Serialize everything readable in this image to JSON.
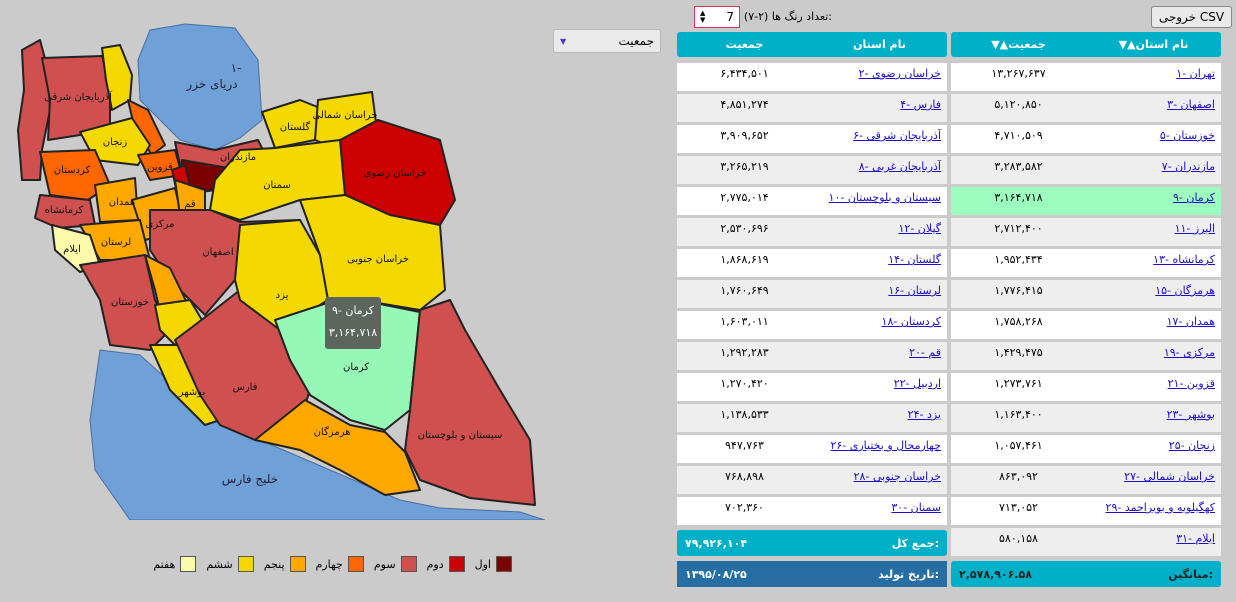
{
  "toolbar": {
    "csv_button": "خروجی CSV",
    "color_count_label": "تعداد رنگ ها (۲-۷):",
    "color_count_value": "7",
    "metric_select": "جمعیت"
  },
  "map": {
    "sea_north": "دریای خزر",
    "sea_north_number": "۱-",
    "sea_south": "خلیج فارس",
    "tooltip": {
      "title": "۹- کرمان",
      "value": "۳,۱۶۴,۷۱۸"
    },
    "provinces": {
      "tehran": "تهران",
      "khorasan_razavi": "خراسان رضوی",
      "esfahan": "اصفهان",
      "fars": "فارس",
      "khuzestan": "خوزستان",
      "azar_sharghi": "آذربایجان شرقی",
      "mazandaran": "مازندران",
      "azar_gharbi": "آذربایجان غربی",
      "kerman": "کرمان",
      "sistan": "سیستان و بلوچستان",
      "alborz": "البرز",
      "gilan": "گیلان",
      "kermanshah": "کرمانشاه",
      "golestan": "گلستان",
      "hormozgan": "هرمزگان",
      "lorestan": "لرستان",
      "hamadan": "همدان",
      "kordestan": "کردستان",
      "markazi": "مرکزی",
      "qom": "قم",
      "qazvin": "قزوین",
      "ardabil": "اردبیل",
      "bushehr": "بوشهر",
      "yazd": "یزد",
      "zanjan": "زنجان",
      "chaharmahal": "چهارمحال و بختیاری",
      "khorasan_shomali": "خراسان شمالی",
      "khorasan_jonubi": "خراسان جنوبی",
      "kohgiluyeh": "کهگیلویه و بویراحمد",
      "semnan": "سمنان",
      "ilam": "ایلام"
    }
  },
  "legend": [
    {
      "label": "اول",
      "color": "#7b0000"
    },
    {
      "label": "دوم",
      "color": "#cc0000"
    },
    {
      "label": "سوم",
      "color": "#d05050"
    },
    {
      "label": "چهارم",
      "color": "#ff6600"
    },
    {
      "label": "پنجم",
      "color": "#ffa800"
    },
    {
      "label": "ششم",
      "color": "#f4d900"
    },
    {
      "label": "هفتم",
      "color": "#fafaaa"
    }
  ],
  "table_right": {
    "header_name": "▼▲نام استان",
    "header_pop": "▼▲جمعیت",
    "rows": [
      {
        "name": "۱- تهران",
        "pop": "۱۳,۲۶۷,۶۳۷"
      },
      {
        "name": "۳- اصفهان",
        "pop": "۵,۱۲۰,۸۵۰"
      },
      {
        "name": "۵- خوزستان",
        "pop": "۴,۷۱۰,۵۰۹"
      },
      {
        "name": "۷- مازندران",
        "pop": "۳,۲۸۳,۵۸۲"
      },
      {
        "name": "۹- کرمان",
        "pop": "۳,۱۶۴,۷۱۸"
      },
      {
        "name": "۱۱- البرز",
        "pop": "۲,۷۱۲,۴۰۰"
      },
      {
        "name": "۱۳- کرمانشاه",
        "pop": "۱,۹۵۲,۴۳۴"
      },
      {
        "name": "۱۵- هرمزگان",
        "pop": "۱,۷۷۶,۴۱۵"
      },
      {
        "name": "۱۷- همدان",
        "pop": "۱,۷۵۸,۲۶۸"
      },
      {
        "name": "۱۹- مرکزی",
        "pop": "۱,۴۲۹,۴۷۵"
      },
      {
        "name": "۲۱- قزوین",
        "pop": "۱,۲۷۳,۷۶۱"
      },
      {
        "name": "۲۳- بوشهر",
        "pop": "۱,۱۶۳,۴۰۰"
      },
      {
        "name": "۲۵- زنجان",
        "pop": "۱,۰۵۷,۴۶۱"
      },
      {
        "name": "۲۷- خراسان شمالی",
        "pop": "۸۶۳,۰۹۲"
      },
      {
        "name": "۲۹- کهگیلویه و بویراحمد",
        "pop": "۷۱۳,۰۵۲"
      },
      {
        "name": "۳۱- ایلام",
        "pop": "۵۸۰,۱۵۸"
      }
    ]
  },
  "table_left": {
    "header_name": "نام استان",
    "header_pop": "جمعیت",
    "rows": [
      {
        "name": "۲- خراسان رضوی",
        "pop": "۶,۴۳۴,۵۰۱"
      },
      {
        "name": "۴- فارس",
        "pop": "۴,۸۵۱,۲۷۴"
      },
      {
        "name": "۶- آذربایجان شرقی",
        "pop": "۳,۹۰۹,۶۵۲"
      },
      {
        "name": "۸- آذربایجان غربی",
        "pop": "۳,۲۶۵,۲۱۹"
      },
      {
        "name": "۱۰- سیستان و بلوچستان",
        "pop": "۲,۷۷۵,۰۱۴"
      },
      {
        "name": "۱۲- گیلان",
        "pop": "۲,۵۳۰,۶۹۶"
      },
      {
        "name": "۱۴- گلستان",
        "pop": "۱,۸۶۸,۶۱۹"
      },
      {
        "name": "۱۶- لرستان",
        "pop": "۱,۷۶۰,۶۴۹"
      },
      {
        "name": "۱۸- کردستان",
        "pop": "۱,۶۰۳,۰۱۱"
      },
      {
        "name": "۲۰- قم",
        "pop": "۱,۲۹۲,۲۸۳"
      },
      {
        "name": "۲۲- اردبیل",
        "pop": "۱,۲۷۰,۴۲۰"
      },
      {
        "name": "۲۴- یزد",
        "pop": "۱,۱۳۸,۵۳۳"
      },
      {
        "name": "۲۶- چهارمحال و بختیاری",
        "pop": "۹۴۷,۷۶۳"
      },
      {
        "name": "۲۸- خراسان جنوبی",
        "pop": "۷۶۸,۸۹۸"
      },
      {
        "name": "۳۰- سمنان",
        "pop": "۷۰۲,۳۶۰"
      }
    ]
  },
  "summary": {
    "total_label": "جمع کل:",
    "total_value": "۷۹,۹۲۶,۱۰۴",
    "date_label": "تاریخ تولید:",
    "date_value": "۱۳۹۵/۰۸/۲۵",
    "avg_label": "میانگین:",
    "avg_value": "۲,۵۷۸,۹۰۶.۵۸"
  }
}
